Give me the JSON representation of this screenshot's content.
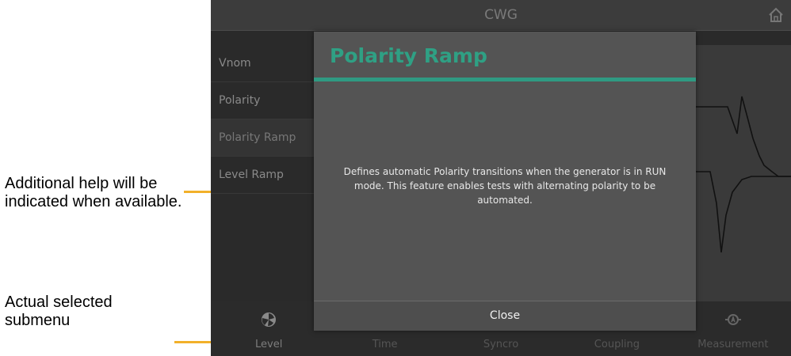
{
  "annotations": {
    "help_note": "Additional help will be indicated when available.",
    "submenu_note": "Actual selected submenu",
    "arrow_color": "#f2b02a"
  },
  "screen": {
    "title": "CWG",
    "home_icon": "home-icon"
  },
  "menu": {
    "items": [
      {
        "label": "Vnom"
      },
      {
        "label": "Polarity"
      },
      {
        "label": "Polarity Ramp"
      },
      {
        "label": "Level Ramp"
      }
    ],
    "selected_index": 2
  },
  "modal": {
    "title": "Polarity Ramp",
    "accent_color": "#2f9a82",
    "body": "Defines automatic Polarity transitions when the generator is in RUN mode. This feature enables tests with alternating polarity to be automated.",
    "close_label": "Close"
  },
  "bottom_tabs": [
    {
      "label": "Level",
      "icon": "level-icon",
      "active": true
    },
    {
      "label": "Time",
      "icon": "time-icon"
    },
    {
      "label": "Syncro",
      "icon": "syncro-icon"
    },
    {
      "label": "Coupling",
      "icon": "coupling-icon"
    },
    {
      "label": "Measurement",
      "icon": "measurement-icon"
    }
  ]
}
